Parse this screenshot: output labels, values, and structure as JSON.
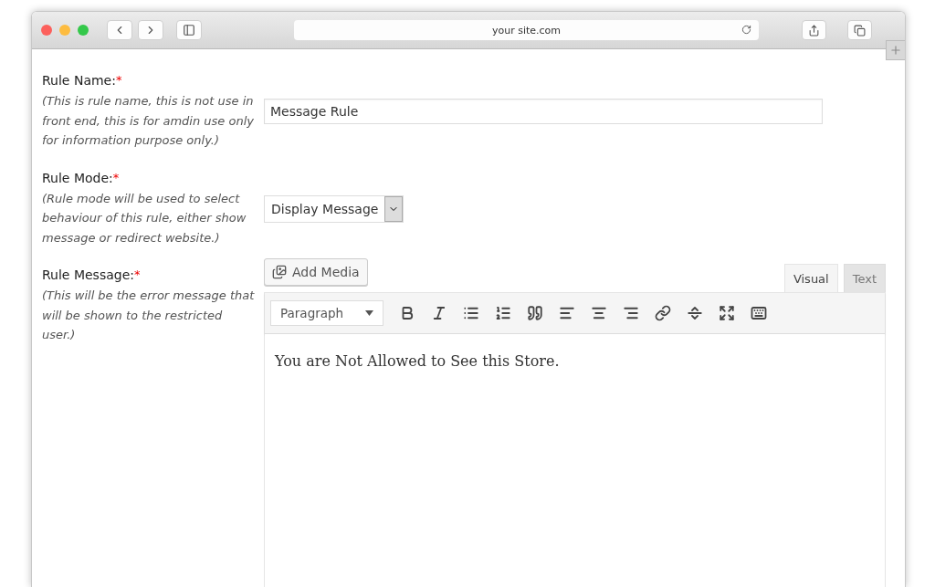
{
  "browser": {
    "url": "your site.com"
  },
  "fields": [
    {
      "kind": "text",
      "label": "Rule Name:",
      "mark": "*",
      "hint": "(This is rule name, this is not use in front end, this is for amdin use only for information purpose only.)",
      "value": "Message Rule"
    },
    {
      "kind": "select",
      "label": "Rule Mode:",
      "mark": "*",
      "hint": "(Rule mode will be used to select behaviour of this rule, either show message or redirect website.)",
      "value": "Display Message"
    },
    {
      "kind": "editor",
      "label": "Rule Message:",
      "mark": "*",
      "hint": "(This will be the error message that will be shown to the restricted user.)",
      "media_button": "Add Media",
      "tabs": [
        {
          "label": "Visual",
          "selected": true
        },
        {
          "label": "Text",
          "selected": false
        }
      ],
      "format": "Paragraph",
      "content": "You are Not Allowed to See this Store."
    }
  ]
}
